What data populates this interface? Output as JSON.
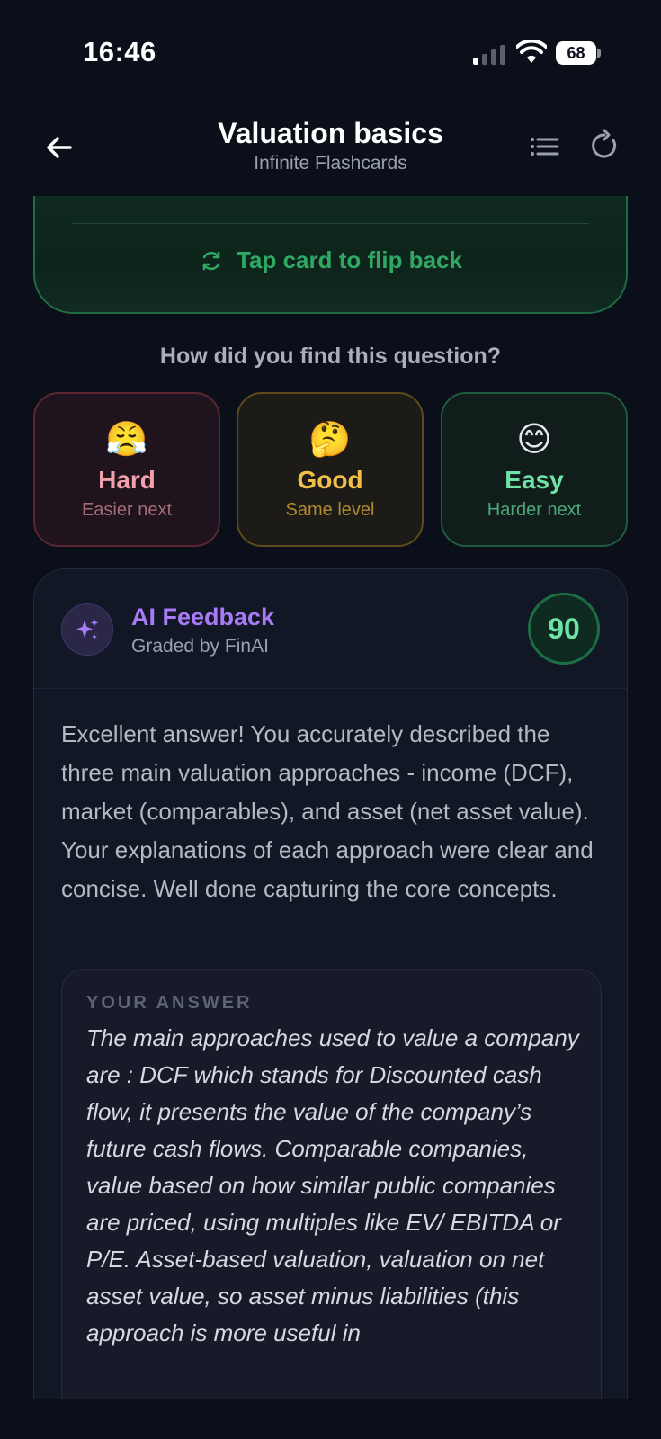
{
  "status_bar": {
    "time": "16:46",
    "battery": "68"
  },
  "header": {
    "title": "Valuation basics",
    "subtitle": "Infinite Flashcards",
    "back_icon": "arrow-left-icon",
    "list_icon": "list-icon",
    "refresh_icon": "refresh-icon"
  },
  "card": {
    "flip_back_label": "Tap card to flip back"
  },
  "difficulty": {
    "question": "How did you find this question?",
    "options": [
      {
        "emoji": "😤",
        "label": "Hard",
        "sub": "Easier next"
      },
      {
        "emoji": "🤔",
        "label": "Good",
        "sub": "Same level"
      },
      {
        "emoji": "😊",
        "label": "Easy",
        "sub": "Harder next"
      }
    ]
  },
  "feedback": {
    "title": "AI Feedback",
    "subtitle": "Graded by FinAI",
    "score": "90",
    "text": "Excellent answer! You accurately described the three main valuation approaches - income (DCF), market (comparables), and asset (net asset value). Your explanations of each approach were clear and concise. Well done capturing the core concepts.",
    "answer_label": "YOUR ANSWER",
    "answer_text": "The main approaches used to value a company are : DCF which stands for Discounted cash flow, it presents the value of the company’s future cash flows. Comparable companies, value based on how similar public companies are priced, using multiples like EV/ EBITDA or P/E. Asset-based valuation, valuation on net asset value, so asset minus liabilities (this approach is more useful in"
  },
  "colors": {
    "background": "#0b0f1a",
    "accent_green": "#2fa864",
    "accent_purple": "#a87af5",
    "hard": "#f3a0aa",
    "good": "#f1be4a",
    "easy": "#6fe3a6"
  }
}
